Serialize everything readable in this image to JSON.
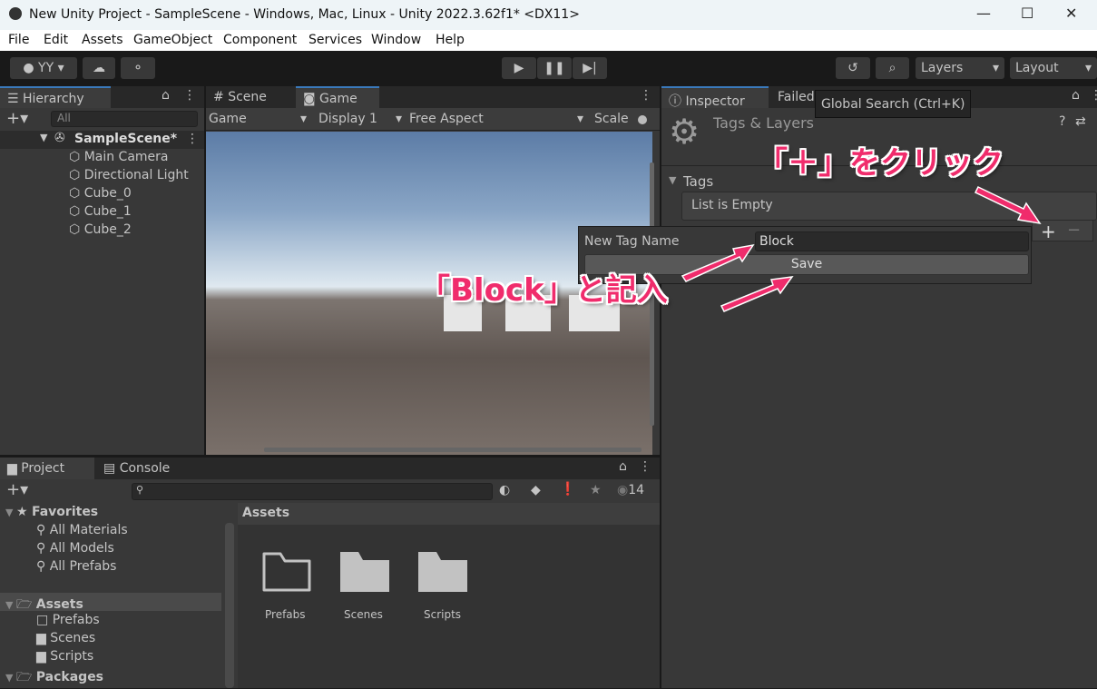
{
  "window": {
    "title": "New Unity Project - SampleScene - Windows, Mac, Linux - Unity 2022.3.62f1* <DX11>",
    "minimize": "—",
    "maximize": "☐",
    "close": "✕"
  },
  "menu": [
    "File",
    "Edit",
    "Assets",
    "GameObject",
    "Component",
    "Services",
    "Window",
    "Help"
  ],
  "toolbar": {
    "account": "YY",
    "layers": "Layers",
    "layout": "Layout"
  },
  "hierarchy": {
    "tab": "Hierarchy",
    "search_placeholder": "All",
    "scene": "SampleScene*",
    "items": [
      "Main Camera",
      "Directional Light",
      "Cube_0",
      "Cube_1",
      "Cube_2"
    ]
  },
  "game": {
    "tabs": [
      "Scene",
      "Game"
    ],
    "mode": "Game",
    "display": "Display 1",
    "aspect": "Free Aspect",
    "scale": "Scale"
  },
  "inspector": {
    "tabs": [
      "Inspector",
      "Failed"
    ],
    "title": "Tags & Layers",
    "tags_label": "Tags",
    "list_empty": "List is Empty",
    "tooltip": "Global Search (Ctrl+K)"
  },
  "popup": {
    "label": "New Tag Name",
    "value": "Block",
    "save": "Save"
  },
  "annotations": {
    "click_plus": "「＋」をクリック",
    "enter_block": "「Block」と記入"
  },
  "project": {
    "tabs": [
      "Project",
      "Console"
    ],
    "hidden_count": "14",
    "favorites": "Favorites",
    "fav_items": [
      "All Materials",
      "All Models",
      "All Prefabs"
    ],
    "assets": "Assets",
    "asset_folders": [
      "Prefabs",
      "Scenes",
      "Scripts"
    ],
    "packages": "Packages",
    "breadcrumb": "Assets",
    "grid": [
      "Prefabs",
      "Scenes",
      "Scripts"
    ]
  },
  "colors": {
    "accent": "#3a79bb",
    "annotation": "#f02c6c"
  }
}
